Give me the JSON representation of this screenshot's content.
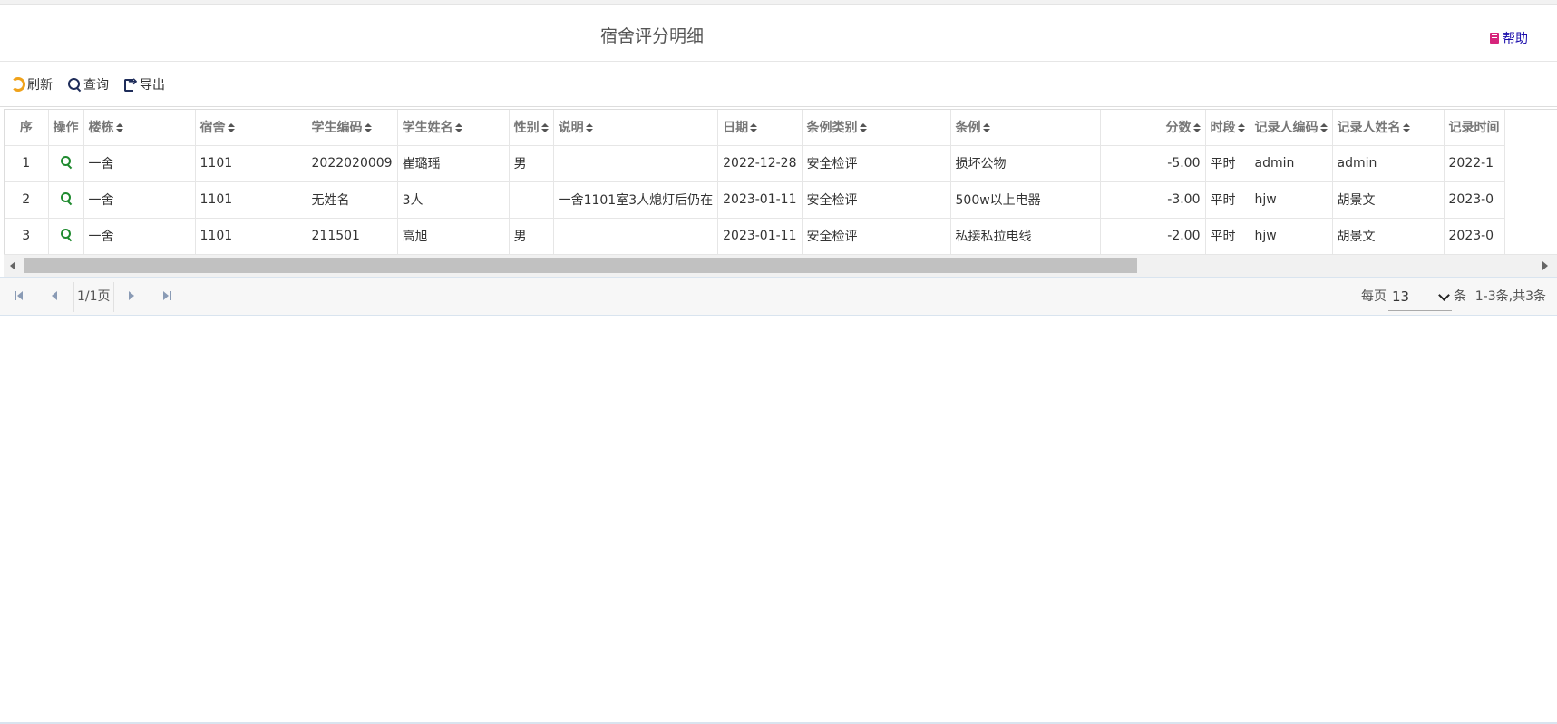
{
  "header": {
    "title": "宿舍评分明细",
    "help_label": "帮助"
  },
  "toolbar": {
    "refresh_label": "刷新",
    "query_label": "查询",
    "export_label": "导出"
  },
  "table": {
    "columns": [
      "序",
      "操作",
      "楼栋",
      "宿舍",
      "学生编码",
      "学生姓名",
      "性别",
      "说明",
      "日期",
      "条例类别",
      "条例",
      "分数",
      "时段",
      "记录人编码",
      "记录人姓名",
      "记录时间"
    ],
    "rows": [
      {
        "seq": "1",
        "building": "一舍",
        "dorm": "1101",
        "student_code": "2022020009",
        "student_name": "崔璐瑶",
        "gender": "男",
        "note": "",
        "date": "2022-12-28",
        "rule_type": "安全检评",
        "rule": "损坏公物",
        "score": "-5.00",
        "period": "平时",
        "recorder_code": "admin",
        "recorder_name": "admin",
        "record_time": "2022-1"
      },
      {
        "seq": "2",
        "building": "一舍",
        "dorm": "1101",
        "student_code": "无姓名",
        "student_name": "3人",
        "gender": "",
        "note": "一舍1101室3人熄灯后仍在",
        "date": "2023-01-11",
        "rule_type": "安全检评",
        "rule": "500w以上电器",
        "score": "-3.00",
        "period": "平时",
        "recorder_code": "hjw",
        "recorder_name": "胡景文",
        "record_time": "2023-0"
      },
      {
        "seq": "3",
        "building": "一舍",
        "dorm": "1101",
        "student_code": "211501",
        "student_name": "高旭",
        "gender": "男",
        "note": "",
        "date": "2023-01-11",
        "rule_type": "安全检评",
        "rule": "私接私拉电线",
        "score": "-2.00",
        "period": "平时",
        "recorder_code": "hjw",
        "recorder_name": "胡景文",
        "record_time": "2023-0"
      }
    ]
  },
  "pager": {
    "page_info": "1/1页",
    "per_page_label": "每页",
    "per_page_value": "13",
    "unit": "条",
    "range": "1-3条,共3条"
  },
  "colors": {
    "refresh_icon": "#f0a21a",
    "view_icon": "#1e8a2e",
    "help_icon": "#d6247b",
    "help_text": "#1a0dab"
  }
}
